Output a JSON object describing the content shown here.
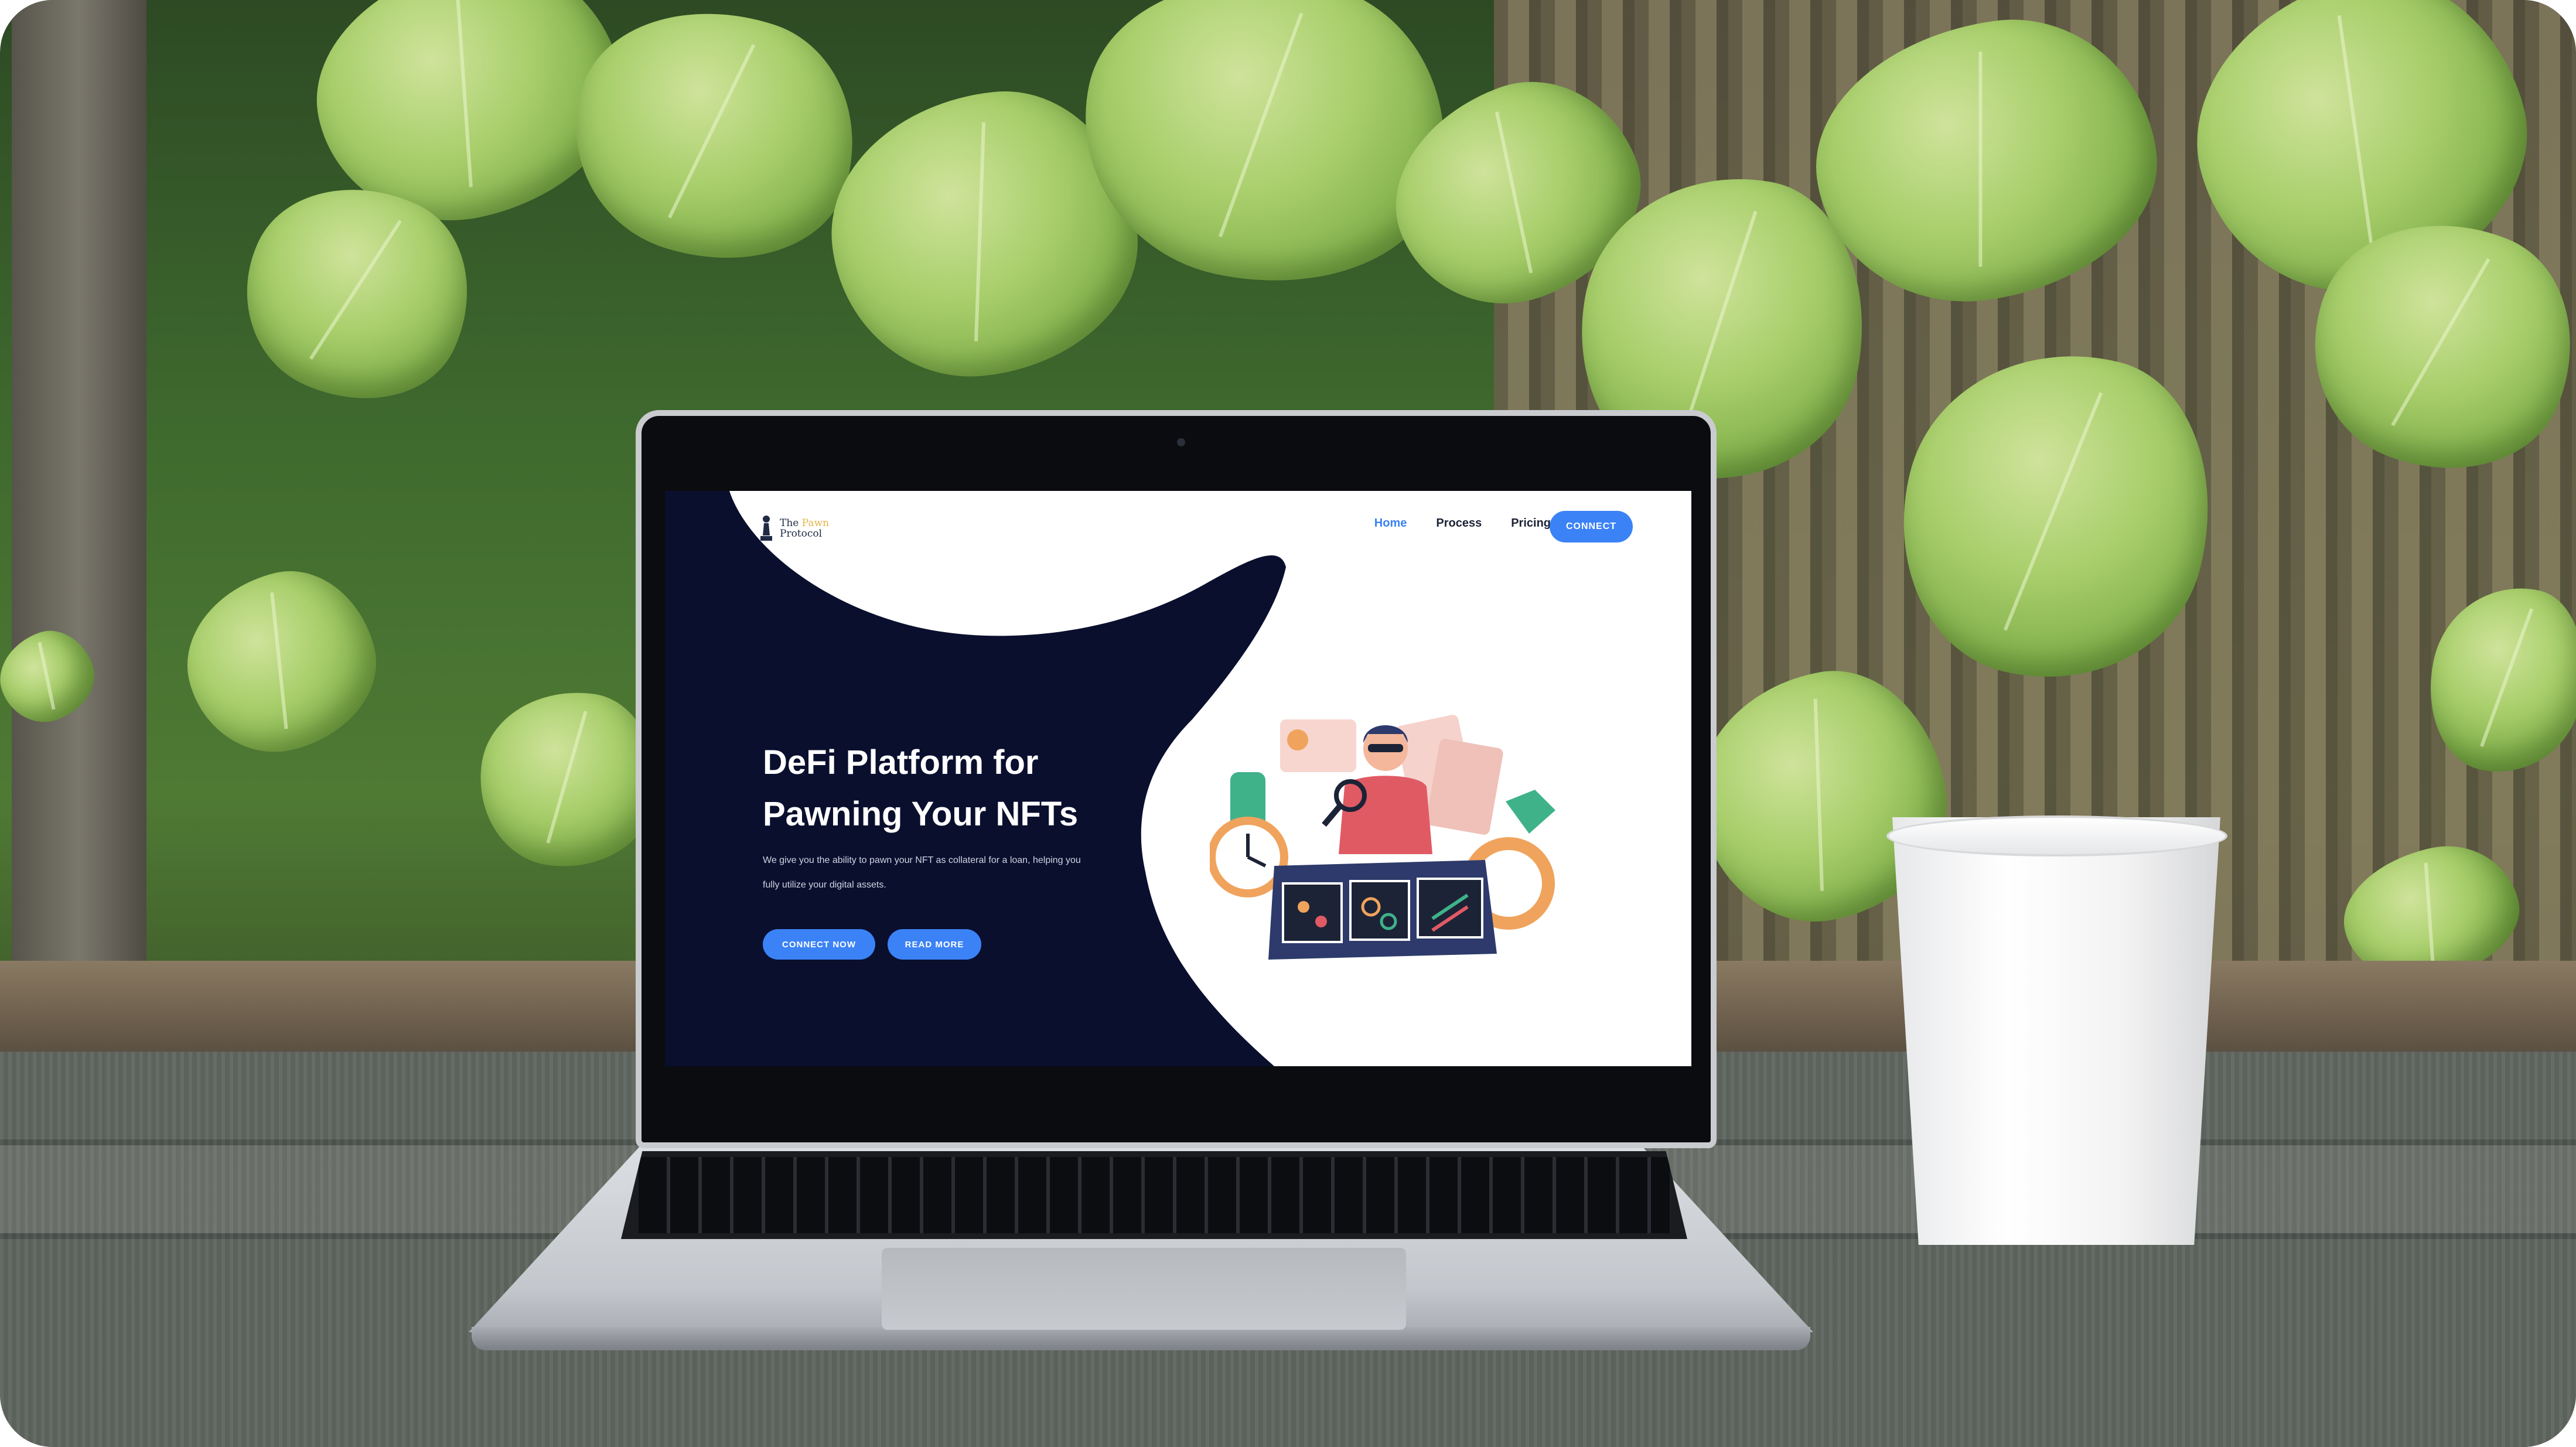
{
  "website": {
    "logo_line1_prefix": "The",
    "logo_line1_accent": "Pawn",
    "logo_line2": "Protocol",
    "nav": {
      "home": "Home",
      "process": "Process",
      "pricing": "Pricing",
      "connect": "CONNECT"
    },
    "hero": {
      "title_line1": "DeFi Platform for",
      "title_line2": "Pawning Your NFTs",
      "description_line1": "We give you the ability to pawn your NFT as collateral for a loan, helping you",
      "description_line2": "fully utilize your digital assets.",
      "primary_button": "CONNECT NOW",
      "secondary_button": "READ MORE"
    },
    "colors": {
      "accent": "#3b82f6",
      "hero_background": "#0a0f2e",
      "nav_text": "#1c2336"
    }
  },
  "scene": {
    "objects": [
      "laptop",
      "paper-cup",
      "wooden-table",
      "green-leaves",
      "fence"
    ]
  }
}
